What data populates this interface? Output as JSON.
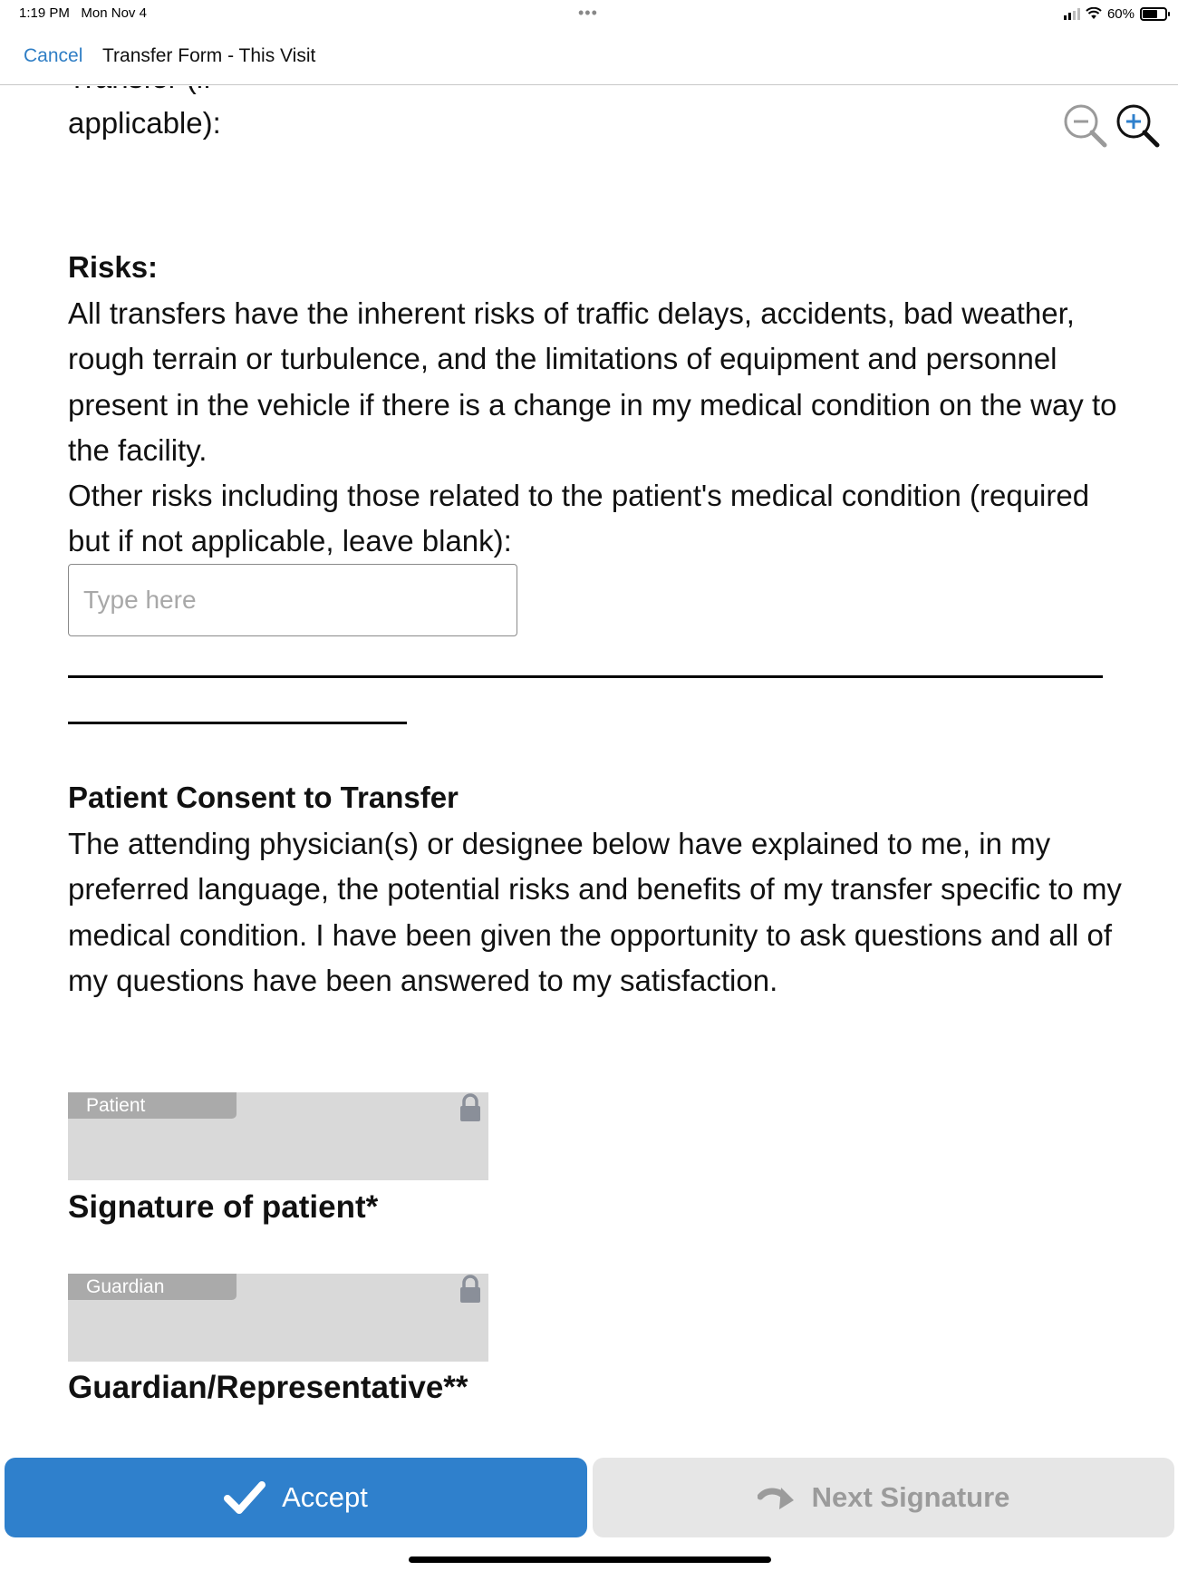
{
  "status_bar": {
    "time": "1:19 PM",
    "date": "Mon Nov 4",
    "battery": "60%"
  },
  "nav": {
    "cancel_label": "Cancel",
    "title": "Transfer Form - This Visit"
  },
  "document": {
    "clipped_label_line1": "Transfer (if",
    "clipped_label_line2": "applicable):",
    "risks_heading": "Risks:",
    "risks_text": "All transfers have the inherent risks of traffic delays, accidents, bad weather, rough terrain or turbulence, and the limitations of equipment and personnel present in the vehicle if there is a change in my medical condition on the way to the facility.",
    "other_risks_text": "Other risks including those related to the patient's medical condition (required but if not applicable, leave blank):",
    "other_risks_placeholder": "Type here",
    "consent_heading": "Patient Consent to Transfer",
    "consent_text": "The attending physician(s) or designee below have explained to me, in my preferred language, the potential risks and benefits of my transfer specific to my medical condition. I have been given the opportunity to ask questions and all of my questions have been answered to my satisfaction.",
    "patient_sig_tag": "Patient",
    "patient_sig_label": "Signature of patient*",
    "guardian_sig_tag": "Guardian",
    "guardian_sig_label": "Guardian/Representative**"
  },
  "actions": {
    "accept_label": "Accept",
    "next_signature_label": "Next Signature"
  },
  "colors": {
    "accent": "#2f80cc",
    "link": "#2f7ec5",
    "disabled_bg": "#e6e6e6",
    "disabled_text": "#9b9b9b",
    "signature_bg": "#d9d9d9"
  }
}
